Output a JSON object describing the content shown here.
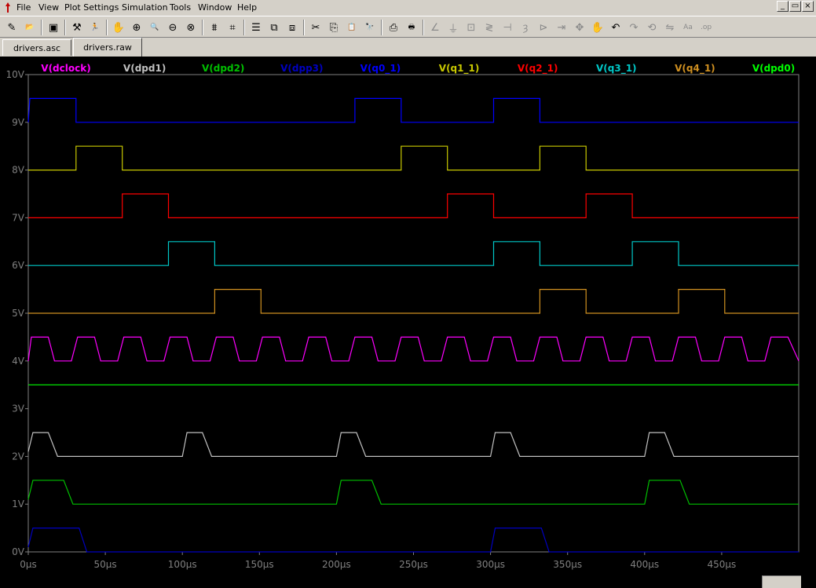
{
  "menu": {
    "items": [
      "File",
      "View",
      "Plot Settings",
      "Simulation",
      "Tools",
      "Window",
      "Help"
    ]
  },
  "window_buttons": {
    "minimize": "_",
    "restore": "▭",
    "close": "×"
  },
  "toolbar": {
    "buttons": [
      {
        "icon": "new-schematic-icon",
        "glyph": "✎",
        "enabled": true
      },
      {
        "icon": "open-icon",
        "glyph": "📂",
        "enabled": true
      },
      {
        "icon": "save-icon",
        "glyph": "▣",
        "enabled": true
      },
      {
        "icon": "control-panel-icon",
        "glyph": "⚒",
        "enabled": true
      },
      {
        "icon": "run-icon",
        "glyph": "🏃",
        "enabled": true
      },
      {
        "icon": "pan-hand-icon",
        "glyph": "✋",
        "enabled": false
      },
      {
        "icon": "zoom-in-icon",
        "glyph": "⊕",
        "enabled": true
      },
      {
        "icon": "zoom-area-icon",
        "glyph": "🔍",
        "enabled": true
      },
      {
        "icon": "zoom-out-icon",
        "glyph": "⊖",
        "enabled": true
      },
      {
        "icon": "zoom-cancel-icon",
        "glyph": "⊗",
        "enabled": true
      },
      {
        "icon": "autorange-icon",
        "glyph": "⩩",
        "enabled": true
      },
      {
        "icon": "fit-icon",
        "glyph": "⌗",
        "enabled": true
      },
      {
        "icon": "tile-horizontal-icon",
        "glyph": "☰",
        "enabled": true
      },
      {
        "icon": "cascade-icon",
        "glyph": "⧉",
        "enabled": true
      },
      {
        "icon": "tile-vertical-icon",
        "glyph": "⧈",
        "enabled": true
      },
      {
        "icon": "cut-icon",
        "glyph": "✂",
        "enabled": true
      },
      {
        "icon": "copy-icon",
        "glyph": "⎘",
        "enabled": true
      },
      {
        "icon": "paste-icon",
        "glyph": "📋",
        "enabled": true
      },
      {
        "icon": "find-icon",
        "glyph": "🔭",
        "enabled": true
      },
      {
        "icon": "print-preview-icon",
        "glyph": "⎙",
        "enabled": true
      },
      {
        "icon": "print-icon",
        "glyph": "🖶",
        "enabled": true
      },
      {
        "icon": "draw-wire-icon",
        "glyph": "∠",
        "enabled": false
      },
      {
        "icon": "ground-icon",
        "glyph": "⏚",
        "enabled": false
      },
      {
        "icon": "label-net-icon",
        "glyph": "⊡",
        "enabled": false
      },
      {
        "icon": "resistor-icon",
        "glyph": "≷",
        "enabled": false
      },
      {
        "icon": "capacitor-icon",
        "glyph": "⊣",
        "enabled": false
      },
      {
        "icon": "inductor-icon",
        "glyph": "ȝ",
        "enabled": false
      },
      {
        "icon": "diode-icon",
        "glyph": "⊳",
        "enabled": false
      },
      {
        "icon": "component-icon",
        "glyph": "⇥",
        "enabled": false
      },
      {
        "icon": "move-icon",
        "glyph": "✥",
        "enabled": false
      },
      {
        "icon": "drag-icon",
        "glyph": "✋",
        "enabled": false
      },
      {
        "icon": "undo-icon",
        "glyph": "↶",
        "enabled": true
      },
      {
        "icon": "redo-icon",
        "glyph": "↷",
        "enabled": false
      },
      {
        "icon": "rotate-icon",
        "glyph": "⟲",
        "enabled": false
      },
      {
        "icon": "mirror-icon",
        "glyph": "⇋",
        "enabled": false
      },
      {
        "icon": "text-icon",
        "glyph": "Aa",
        "enabled": false
      },
      {
        "icon": "spice-directive-icon",
        "glyph": ".op",
        "enabled": false
      }
    ]
  },
  "tabs": [
    {
      "label": "drivers.asc",
      "active": false
    },
    {
      "label": "drivers.raw",
      "active": true
    }
  ],
  "plot": {
    "background": "#000000",
    "axis_color": "#808080"
  },
  "chart_data": {
    "type": "line",
    "title": "",
    "xlabel": "",
    "ylabel": "",
    "xlim": [
      0,
      500
    ],
    "ylim": [
      0,
      10
    ],
    "x_unit": "µs",
    "grid": false,
    "x_ticks": [
      "0µs",
      "50µs",
      "100µs",
      "150µs",
      "200µs",
      "250µs",
      "300µs",
      "350µs",
      "400µs",
      "450µs"
    ],
    "x_tick_values": [
      0,
      50,
      100,
      150,
      200,
      250,
      300,
      350,
      400,
      450
    ],
    "y_ticks": [
      "0V",
      "1V",
      "2V",
      "3V",
      "4V",
      "5V",
      "6V",
      "7V",
      "8V",
      "9V",
      "10V"
    ],
    "y_tick_values": [
      0,
      1,
      2,
      3,
      4,
      5,
      6,
      7,
      8,
      9,
      10
    ],
    "legend_position": "top",
    "series": [
      {
        "name": "V(dclock)",
        "color": "#ff00ff",
        "points": [
          [
            0,
            4.0
          ],
          [
            2,
            4.5
          ],
          [
            13,
            4.5
          ],
          [
            17,
            4.0
          ],
          [
            28,
            4.0
          ],
          [
            32,
            4.5
          ],
          [
            43,
            4.5
          ],
          [
            47,
            4.0
          ],
          [
            58,
            4.0
          ],
          [
            62,
            4.5
          ],
          [
            73,
            4.5
          ],
          [
            77,
            4.0
          ],
          [
            88,
            4.0
          ],
          [
            92,
            4.5
          ],
          [
            103,
            4.5
          ],
          [
            107,
            4.0
          ],
          [
            118,
            4.0
          ],
          [
            122,
            4.5
          ],
          [
            133,
            4.5
          ],
          [
            137,
            4.0
          ],
          [
            148,
            4.0
          ],
          [
            152,
            4.5
          ],
          [
            163,
            4.5
          ],
          [
            167,
            4.0
          ],
          [
            178,
            4.0
          ],
          [
            182,
            4.5
          ],
          [
            193,
            4.5
          ],
          [
            197,
            4.0
          ],
          [
            208,
            4.0
          ],
          [
            212,
            4.5
          ],
          [
            223,
            4.5
          ],
          [
            227,
            4.0
          ],
          [
            238,
            4.0
          ],
          [
            242,
            4.5
          ],
          [
            253,
            4.5
          ],
          [
            257,
            4.0
          ],
          [
            268,
            4.0
          ],
          [
            272,
            4.5
          ],
          [
            283,
            4.5
          ],
          [
            287,
            4.0
          ],
          [
            298,
            4.0
          ],
          [
            302,
            4.5
          ],
          [
            313,
            4.5
          ],
          [
            317,
            4.0
          ],
          [
            328,
            4.0
          ],
          [
            332,
            4.5
          ],
          [
            343,
            4.5
          ],
          [
            347,
            4.0
          ],
          [
            358,
            4.0
          ],
          [
            362,
            4.5
          ],
          [
            373,
            4.5
          ],
          [
            377,
            4.0
          ],
          [
            388,
            4.0
          ],
          [
            392,
            4.5
          ],
          [
            403,
            4.5
          ],
          [
            407,
            4.0
          ],
          [
            418,
            4.0
          ],
          [
            422,
            4.5
          ],
          [
            433,
            4.5
          ],
          [
            437,
            4.0
          ],
          [
            448,
            4.0
          ],
          [
            452,
            4.5
          ],
          [
            463,
            4.5
          ],
          [
            467,
            4.0
          ],
          [
            478,
            4.0
          ],
          [
            482,
            4.5
          ],
          [
            493,
            4.5
          ],
          [
            500,
            4.0
          ]
        ]
      },
      {
        "name": "V(dpd1)",
        "color": "#c0c0c0",
        "points": [
          [
            0,
            2.1
          ],
          [
            3,
            2.5
          ],
          [
            13,
            2.5
          ],
          [
            19,
            2.0
          ],
          [
            100,
            2.0
          ],
          [
            103,
            2.5
          ],
          [
            113,
            2.5
          ],
          [
            119,
            2.0
          ],
          [
            200,
            2.0
          ],
          [
            203,
            2.5
          ],
          [
            213,
            2.5
          ],
          [
            219,
            2.0
          ],
          [
            300,
            2.0
          ],
          [
            303,
            2.5
          ],
          [
            313,
            2.5
          ],
          [
            319,
            2.0
          ],
          [
            400,
            2.0
          ],
          [
            403,
            2.5
          ],
          [
            413,
            2.5
          ],
          [
            419,
            2.0
          ],
          [
            500,
            2.0
          ]
        ]
      },
      {
        "name": "V(dpd2)",
        "color": "#00c000",
        "points": [
          [
            0,
            1.1
          ],
          [
            3,
            1.5
          ],
          [
            23,
            1.5
          ],
          [
            29,
            1.0
          ],
          [
            200,
            1.0
          ],
          [
            203,
            1.5
          ],
          [
            223,
            1.5
          ],
          [
            229,
            1.0
          ],
          [
            400,
            1.0
          ],
          [
            403,
            1.5
          ],
          [
            423,
            1.5
          ],
          [
            429,
            1.0
          ],
          [
            500,
            1.0
          ]
        ]
      },
      {
        "name": "V(dpp3)",
        "color": "#0000c0",
        "points": [
          [
            0,
            0.1
          ],
          [
            3,
            0.5
          ],
          [
            33,
            0.5
          ],
          [
            38,
            0.0
          ],
          [
            300,
            0.0
          ],
          [
            303,
            0.5
          ],
          [
            333,
            0.5
          ],
          [
            338,
            0.0
          ],
          [
            500,
            0.0
          ]
        ]
      },
      {
        "name": "V(q0_1)",
        "color": "#0000ff",
        "points": [
          [
            0,
            9.0
          ],
          [
            1,
            9.5
          ],
          [
            31,
            9.5
          ],
          [
            31,
            9.0
          ],
          [
            212,
            9.0
          ],
          [
            212,
            9.5
          ],
          [
            242,
            9.5
          ],
          [
            242,
            9.0
          ],
          [
            302,
            9.0
          ],
          [
            302,
            9.5
          ],
          [
            332,
            9.5
          ],
          [
            332,
            9.0
          ],
          [
            500,
            9.0
          ]
        ]
      },
      {
        "name": "V(q1_1)",
        "color": "#c8c800",
        "points": [
          [
            0,
            8.0
          ],
          [
            31,
            8.0
          ],
          [
            31,
            8.5
          ],
          [
            61,
            8.5
          ],
          [
            61,
            8.0
          ],
          [
            242,
            8.0
          ],
          [
            242,
            8.5
          ],
          [
            272,
            8.5
          ],
          [
            272,
            8.0
          ],
          [
            332,
            8.0
          ],
          [
            332,
            8.5
          ],
          [
            362,
            8.5
          ],
          [
            362,
            8.0
          ],
          [
            500,
            8.0
          ]
        ]
      },
      {
        "name": "V(q2_1)",
        "color": "#ff0000",
        "points": [
          [
            0,
            7.0
          ],
          [
            61,
            7.0
          ],
          [
            61,
            7.5
          ],
          [
            91,
            7.5
          ],
          [
            91,
            7.0
          ],
          [
            272,
            7.0
          ],
          [
            272,
            7.5
          ],
          [
            302,
            7.5
          ],
          [
            302,
            7.0
          ],
          [
            362,
            7.0
          ],
          [
            362,
            7.5
          ],
          [
            392,
            7.5
          ],
          [
            392,
            7.0
          ],
          [
            500,
            7.0
          ]
        ]
      },
      {
        "name": "V(q3_1)",
        "color": "#00c8c8",
        "points": [
          [
            0,
            6.0
          ],
          [
            91,
            6.0
          ],
          [
            91,
            6.5
          ],
          [
            121,
            6.5
          ],
          [
            121,
            6.0
          ],
          [
            302,
            6.0
          ],
          [
            302,
            6.5
          ],
          [
            332,
            6.5
          ],
          [
            332,
            6.0
          ],
          [
            392,
            6.0
          ],
          [
            392,
            6.5
          ],
          [
            422,
            6.5
          ],
          [
            422,
            6.0
          ],
          [
            500,
            6.0
          ]
        ]
      },
      {
        "name": "V(q4_1)",
        "color": "#d09020",
        "points": [
          [
            0,
            5.0
          ],
          [
            121,
            5.0
          ],
          [
            121,
            5.5
          ],
          [
            151,
            5.5
          ],
          [
            151,
            5.0
          ],
          [
            332,
            5.0
          ],
          [
            332,
            5.5
          ],
          [
            362,
            5.5
          ],
          [
            362,
            5.0
          ],
          [
            422,
            5.0
          ],
          [
            422,
            5.5
          ],
          [
            452,
            5.5
          ],
          [
            452,
            5.0
          ],
          [
            500,
            5.0
          ]
        ]
      },
      {
        "name": "V(dpd0)",
        "color": "#00ff00",
        "points": [
          [
            0,
            3.5
          ],
          [
            500,
            3.5
          ]
        ]
      }
    ]
  }
}
